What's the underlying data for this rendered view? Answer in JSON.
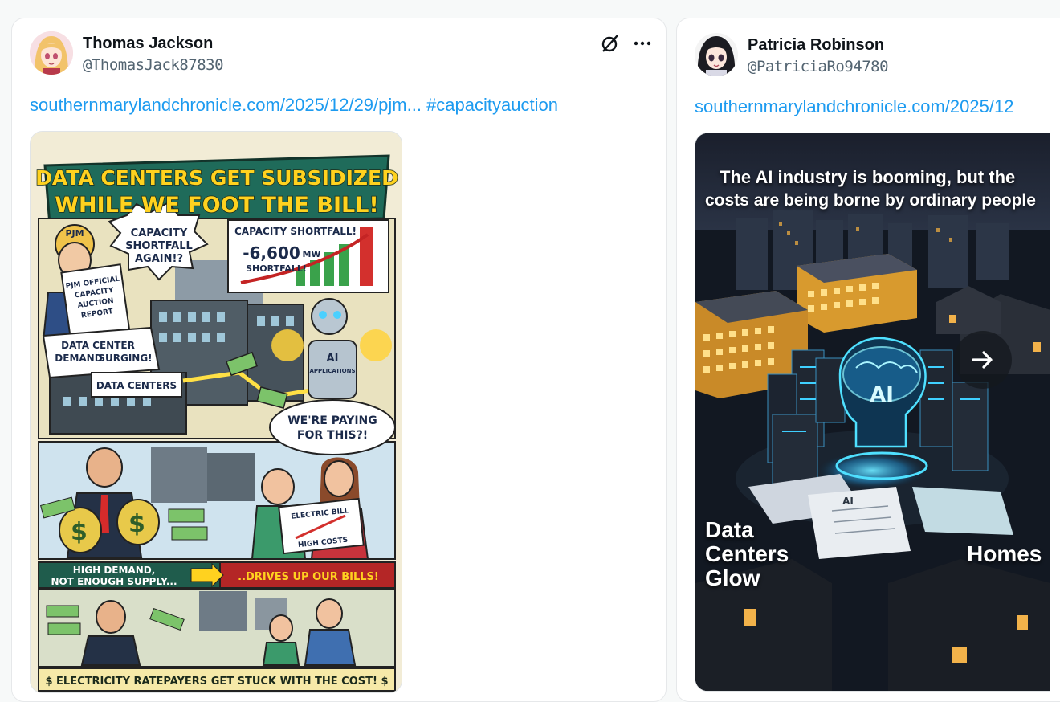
{
  "posts": [
    {
      "author_name": "Thomas Jackson",
      "author_handle": "@ThomasJack87830",
      "link_text": "southernmarylandchronicle.com/2025/12/29/pjm...",
      "hashtag": "#capacityauction",
      "icons": [
        "grok-icon",
        "more-icon"
      ],
      "media": {
        "title_line1": "DATA CENTERS GET SUBSIDIZED",
        "title_line2": "WHILE WE FOOT THE BILL!",
        "pjm_hat": "PJM",
        "bubble_shortfall": [
          "CAPACITY",
          "SHORTFALL",
          "AGAIN!?"
        ],
        "chart_title": "CAPACITY SHORTFALL!",
        "chart_value": "-6,600",
        "chart_unit": "MW",
        "chart_label": "SHORTFALL!",
        "report": [
          "PJM OFFICIAL",
          "CAPACITY",
          "AUCTION",
          "REPORT"
        ],
        "demand": [
          "DATA CENTER",
          "DEMAND",
          "SURGING!"
        ],
        "data_centers_sign": "DATA CENTERS",
        "robot_chest": "AI",
        "robot_label": "APPLICATIONS",
        "bubble_paying": [
          "WE'RE PAYING",
          "FOR THIS?!"
        ],
        "bill_title": "ELECTRIC BILL",
        "bill_costs": "HIGH COSTS",
        "supply_line1": "HIGH DEMAND,",
        "supply_line2": "NOT ENOUGH SUPPLY...",
        "drives": "..DRIVES UP OUR BILLS!",
        "footer": "$ ELECTRICITY RATEPAYERS GET STUCK WITH THE COST! $"
      }
    },
    {
      "author_name": "Patricia Robinson",
      "author_handle": "@PatriciaRo94780",
      "link_text": "southernmarylandchronicle.com/2025/12",
      "media": {
        "headline_line1": "The AI industry is booming, but the",
        "headline_line2": "costs are being borne by ordinary people",
        "brain_label": "AI",
        "paper_label": "AI",
        "left_label": [
          "Data",
          "Centers",
          "Glow"
        ],
        "right_label": "Homes",
        "next_icon": "arrow-right-icon"
      }
    }
  ],
  "colors": {
    "link": "#1d9bf0",
    "handle": "#536471",
    "name": "#0f1419"
  }
}
